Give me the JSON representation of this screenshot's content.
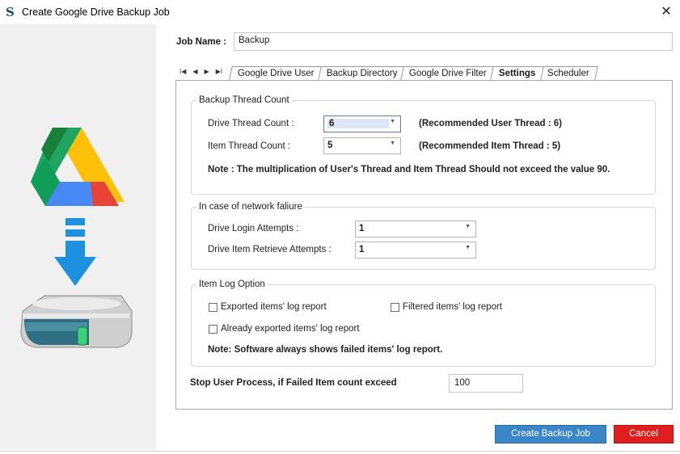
{
  "window": {
    "title": "Create Google Drive Backup Job",
    "app_icon_glyph": "S",
    "close_glyph": "✕"
  },
  "job": {
    "label": "Job Name :",
    "value": "Backup"
  },
  "tab_nav": {
    "first": "I◀",
    "prev": "◀",
    "next": "▶",
    "last": "▶I"
  },
  "tabs": [
    {
      "label": "Google Drive User"
    },
    {
      "label": "Backup Directory"
    },
    {
      "label": "Google Drive Filter"
    },
    {
      "label": "Settings"
    },
    {
      "label": "Scheduler"
    }
  ],
  "thread": {
    "legend": "Backup Thread Count",
    "drive_label": "Drive Thread Count :",
    "drive_value": "6",
    "drive_recommend": "(Recommended User Thread : 6)",
    "item_label": "Item Thread Count :",
    "item_value": "5",
    "item_recommend": "(Recommended Item Thread : 5)",
    "note": "Note : The multiplication of User's Thread and Item Thread Should not exceed the value 90."
  },
  "network": {
    "legend": "In case of network faliure",
    "login_label": "Drive Login Attempts :",
    "login_value": "1",
    "retrieve_label": "Drive Item Retrieve Attempts :",
    "retrieve_value": "1"
  },
  "log": {
    "legend": "Item Log Option",
    "exported": "Exported items' log report",
    "filtered": "Filtered items' log report",
    "already": "Already exported items' log report",
    "note": "Note: Software always shows failed items' log report."
  },
  "stop": {
    "label": "Stop User Process, if Failed Item count exceed",
    "value": "100"
  },
  "buttons": {
    "create": "Create Backup Job",
    "cancel": "Cancel"
  },
  "colors": {
    "primary": "#3b86c6",
    "danger": "#e01e1e",
    "drive_green": "#1fa463",
    "drive_yellow": "#ffd04b",
    "drive_blue": "#4688f4",
    "arrow_blue": "#1e90e0"
  }
}
